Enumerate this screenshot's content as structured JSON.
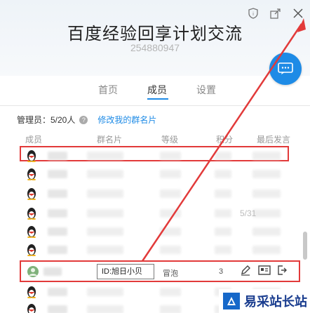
{
  "header": {
    "title": "百度经验回享计划交流",
    "group_id": "254880947",
    "icons": [
      "shield-icon",
      "share-icon",
      "close-icon"
    ]
  },
  "tabs": [
    {
      "label": "首页",
      "active": false
    },
    {
      "label": "成员",
      "active": true
    },
    {
      "label": "设置",
      "active": false
    }
  ],
  "admin": {
    "label": "管理员：5/20人",
    "edit_link": "修改我的群名片"
  },
  "table": {
    "columns": [
      "成员",
      "群名片",
      "等级",
      "积分",
      "最后发言"
    ],
    "partial_date": "5/31",
    "highlighted_row": {
      "name_card_value": "ID:旭日小贝",
      "level": "冒泡",
      "points": "3"
    }
  },
  "watermark": {
    "text": "易采站长站"
  },
  "colors": {
    "accent": "#1e8be6",
    "highlight": "#e23a3a"
  }
}
